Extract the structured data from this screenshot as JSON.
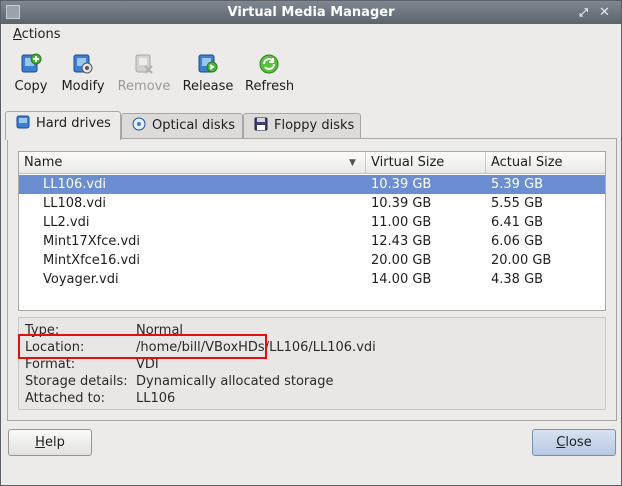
{
  "window": {
    "title": "Virtual Media Manager"
  },
  "menu": {
    "actions": "Actions"
  },
  "toolbar": {
    "copy": "Copy",
    "modify": "Modify",
    "remove": "Remove",
    "release": "Release",
    "refresh": "Refresh"
  },
  "tabs": {
    "hard_drives": "Hard drives",
    "optical_disks": "Optical disks",
    "floppy_disks": "Floppy disks"
  },
  "table": {
    "columns": [
      "Name",
      "Virtual Size",
      "Actual Size"
    ],
    "rows": [
      {
        "name": "LL106.vdi",
        "virtual": "10.39 GB",
        "actual": "5.39 GB"
      },
      {
        "name": "LL108.vdi",
        "virtual": "10.39 GB",
        "actual": "5.55 GB"
      },
      {
        "name": "LL2.vdi",
        "virtual": "11.00 GB",
        "actual": "6.41 GB"
      },
      {
        "name": "Mint17Xfce.vdi",
        "virtual": "12.43 GB",
        "actual": "6.06 GB"
      },
      {
        "name": "MintXfce16.vdi",
        "virtual": "20.00 GB",
        "actual": "20.00 GB"
      },
      {
        "name": "Voyager.vdi",
        "virtual": "14.00 GB",
        "actual": "4.38 GB"
      }
    ]
  },
  "details": {
    "type_label": "Type:",
    "type_value": "Normal",
    "location_label": "Location:",
    "location_value": "/home/bill/VBoxHDs/LL106/LL106.vdi",
    "format_label": "Format:",
    "format_value": "VDI",
    "storage_label": "Storage details:",
    "storage_value": "Dynamically allocated storage",
    "attached_label": "Attached to:",
    "attached_value": "LL106"
  },
  "buttons": {
    "help": "Help",
    "close": "Close"
  },
  "colors": {
    "selection": "#6a8ed1",
    "highlight_box": "#e01010"
  }
}
